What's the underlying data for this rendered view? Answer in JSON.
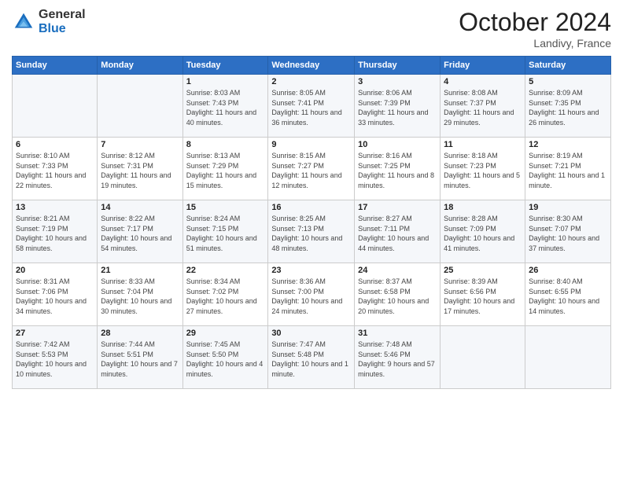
{
  "logo": {
    "general": "General",
    "blue": "Blue"
  },
  "title": "October 2024",
  "subtitle": "Landivy, France",
  "days_header": [
    "Sunday",
    "Monday",
    "Tuesday",
    "Wednesday",
    "Thursday",
    "Friday",
    "Saturday"
  ],
  "weeks": [
    [
      {
        "day": "",
        "info": ""
      },
      {
        "day": "",
        "info": ""
      },
      {
        "day": "1",
        "info": "Sunrise: 8:03 AM\nSunset: 7:43 PM\nDaylight: 11 hours and 40 minutes."
      },
      {
        "day": "2",
        "info": "Sunrise: 8:05 AM\nSunset: 7:41 PM\nDaylight: 11 hours and 36 minutes."
      },
      {
        "day": "3",
        "info": "Sunrise: 8:06 AM\nSunset: 7:39 PM\nDaylight: 11 hours and 33 minutes."
      },
      {
        "day": "4",
        "info": "Sunrise: 8:08 AM\nSunset: 7:37 PM\nDaylight: 11 hours and 29 minutes."
      },
      {
        "day": "5",
        "info": "Sunrise: 8:09 AM\nSunset: 7:35 PM\nDaylight: 11 hours and 26 minutes."
      }
    ],
    [
      {
        "day": "6",
        "info": "Sunrise: 8:10 AM\nSunset: 7:33 PM\nDaylight: 11 hours and 22 minutes."
      },
      {
        "day": "7",
        "info": "Sunrise: 8:12 AM\nSunset: 7:31 PM\nDaylight: 11 hours and 19 minutes."
      },
      {
        "day": "8",
        "info": "Sunrise: 8:13 AM\nSunset: 7:29 PM\nDaylight: 11 hours and 15 minutes."
      },
      {
        "day": "9",
        "info": "Sunrise: 8:15 AM\nSunset: 7:27 PM\nDaylight: 11 hours and 12 minutes."
      },
      {
        "day": "10",
        "info": "Sunrise: 8:16 AM\nSunset: 7:25 PM\nDaylight: 11 hours and 8 minutes."
      },
      {
        "day": "11",
        "info": "Sunrise: 8:18 AM\nSunset: 7:23 PM\nDaylight: 11 hours and 5 minutes."
      },
      {
        "day": "12",
        "info": "Sunrise: 8:19 AM\nSunset: 7:21 PM\nDaylight: 11 hours and 1 minute."
      }
    ],
    [
      {
        "day": "13",
        "info": "Sunrise: 8:21 AM\nSunset: 7:19 PM\nDaylight: 10 hours and 58 minutes."
      },
      {
        "day": "14",
        "info": "Sunrise: 8:22 AM\nSunset: 7:17 PM\nDaylight: 10 hours and 54 minutes."
      },
      {
        "day": "15",
        "info": "Sunrise: 8:24 AM\nSunset: 7:15 PM\nDaylight: 10 hours and 51 minutes."
      },
      {
        "day": "16",
        "info": "Sunrise: 8:25 AM\nSunset: 7:13 PM\nDaylight: 10 hours and 48 minutes."
      },
      {
        "day": "17",
        "info": "Sunrise: 8:27 AM\nSunset: 7:11 PM\nDaylight: 10 hours and 44 minutes."
      },
      {
        "day": "18",
        "info": "Sunrise: 8:28 AM\nSunset: 7:09 PM\nDaylight: 10 hours and 41 minutes."
      },
      {
        "day": "19",
        "info": "Sunrise: 8:30 AM\nSunset: 7:07 PM\nDaylight: 10 hours and 37 minutes."
      }
    ],
    [
      {
        "day": "20",
        "info": "Sunrise: 8:31 AM\nSunset: 7:06 PM\nDaylight: 10 hours and 34 minutes."
      },
      {
        "day": "21",
        "info": "Sunrise: 8:33 AM\nSunset: 7:04 PM\nDaylight: 10 hours and 30 minutes."
      },
      {
        "day": "22",
        "info": "Sunrise: 8:34 AM\nSunset: 7:02 PM\nDaylight: 10 hours and 27 minutes."
      },
      {
        "day": "23",
        "info": "Sunrise: 8:36 AM\nSunset: 7:00 PM\nDaylight: 10 hours and 24 minutes."
      },
      {
        "day": "24",
        "info": "Sunrise: 8:37 AM\nSunset: 6:58 PM\nDaylight: 10 hours and 20 minutes."
      },
      {
        "day": "25",
        "info": "Sunrise: 8:39 AM\nSunset: 6:56 PM\nDaylight: 10 hours and 17 minutes."
      },
      {
        "day": "26",
        "info": "Sunrise: 8:40 AM\nSunset: 6:55 PM\nDaylight: 10 hours and 14 minutes."
      }
    ],
    [
      {
        "day": "27",
        "info": "Sunrise: 7:42 AM\nSunset: 5:53 PM\nDaylight: 10 hours and 10 minutes."
      },
      {
        "day": "28",
        "info": "Sunrise: 7:44 AM\nSunset: 5:51 PM\nDaylight: 10 hours and 7 minutes."
      },
      {
        "day": "29",
        "info": "Sunrise: 7:45 AM\nSunset: 5:50 PM\nDaylight: 10 hours and 4 minutes."
      },
      {
        "day": "30",
        "info": "Sunrise: 7:47 AM\nSunset: 5:48 PM\nDaylight: 10 hours and 1 minute."
      },
      {
        "day": "31",
        "info": "Sunrise: 7:48 AM\nSunset: 5:46 PM\nDaylight: 9 hours and 57 minutes."
      },
      {
        "day": "",
        "info": ""
      },
      {
        "day": "",
        "info": ""
      }
    ]
  ]
}
